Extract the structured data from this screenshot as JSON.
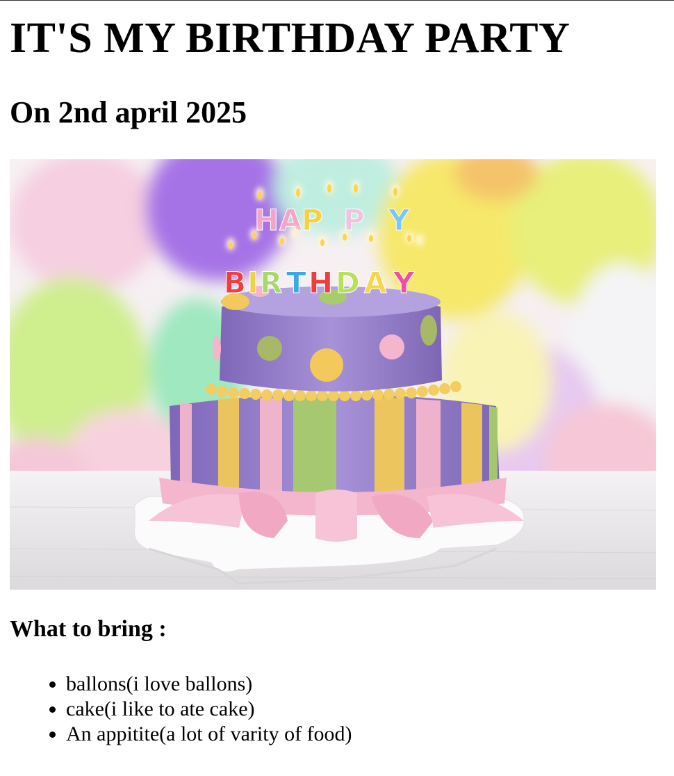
{
  "page": {
    "title": "IT'S MY BIRTHDAY PARTY",
    "date": "On 2nd april 2025"
  },
  "image": {
    "subject": "birthday-cake-photo",
    "candle_letters": "HAPPY BIRTHDAY"
  },
  "bring": {
    "heading": "What to bring :",
    "items": [
      "ballons(i love ballons)",
      "cake(i like to ate cake)",
      "An appitite(a lot of varity of food)"
    ]
  },
  "colors": {
    "cake_purple": "#9b82cf",
    "stripe_yellow": "#f2c95a",
    "stripe_green": "#a7cc6b",
    "stripe_pink": "#f4b6cc"
  }
}
